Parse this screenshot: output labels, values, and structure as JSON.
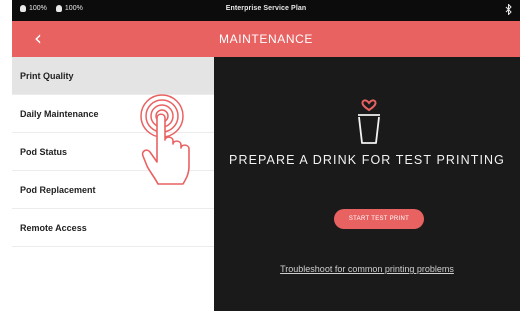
{
  "status_bar": {
    "battery_1": "100%",
    "battery_2": "100%",
    "title": "Enterprise Service Plan",
    "bluetooth_icon": "bluetooth-icon"
  },
  "header": {
    "back_icon": "chevron-left-icon",
    "back_glyph": "‹",
    "title": "MAINTENANCE"
  },
  "sidebar": {
    "items": [
      {
        "label": "Print Quality",
        "active": true
      },
      {
        "label": "Daily Maintenance",
        "active": false
      },
      {
        "label": "Pod Status",
        "active": false
      },
      {
        "label": "Pod Replacement",
        "active": false
      },
      {
        "label": "Remote Access",
        "active": false
      }
    ]
  },
  "main": {
    "icon": "cup-with-heart-icon",
    "title": "PREPARE A DRINK FOR TEST PRINTING",
    "start_button_label": "START TEST PRINT",
    "help_link": "Troubleshoot for common printing problems"
  },
  "overlay": {
    "icon": "tap-hand-icon"
  },
  "colors": {
    "accent": "#e96262",
    "content_background": "#1a1a1a",
    "sidebar_active": "#e4e4e4",
    "status_bar": "#0c0c0c"
  }
}
